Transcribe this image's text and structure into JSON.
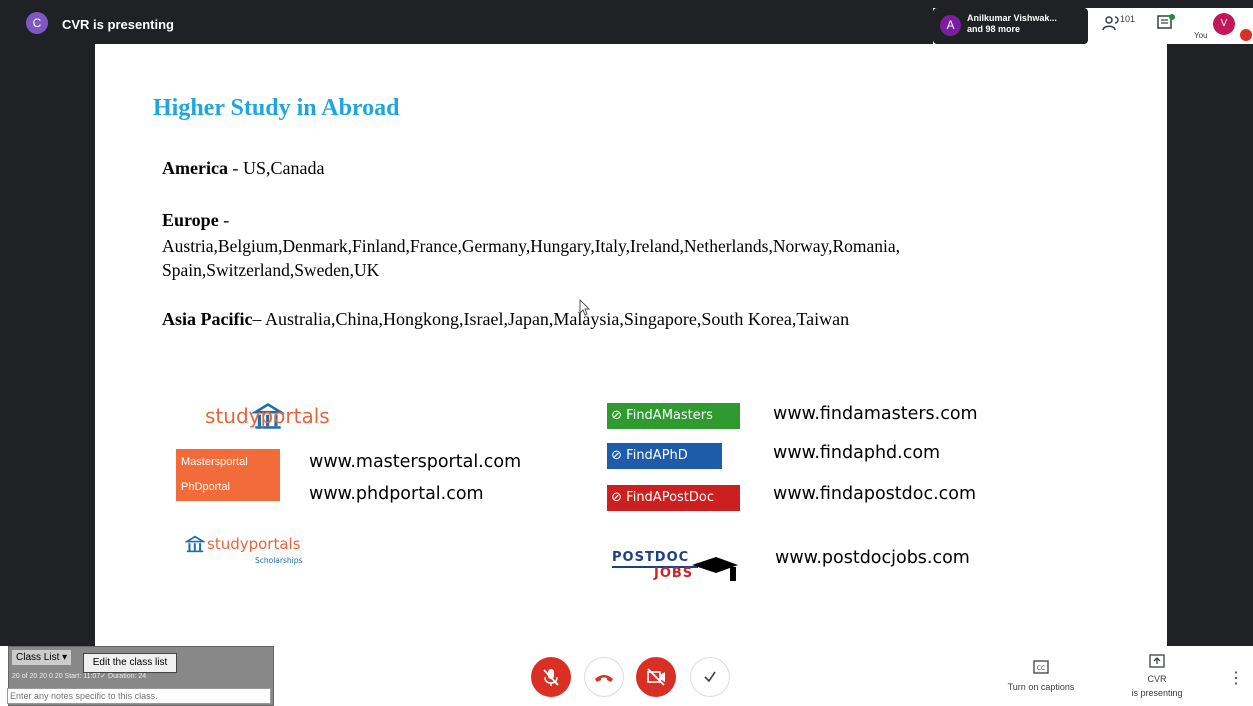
{
  "topbar": {
    "presenter_initial": "C",
    "presenter_text": "CVR is presenting",
    "people_initial": "A",
    "people_line1": "Anilkumar Vishwak...",
    "people_line2": "and 98 more",
    "participant_count": "101",
    "you_label": "You",
    "you_initial": "V"
  },
  "slide": {
    "title": "Higher Study in Abroad",
    "america_label": "America",
    "america_sep": " - ",
    "america_countries": "US,Canada",
    "europe_label": "Europe",
    "europe_sep": " -",
    "europe_countries_line1": "Austria,Belgium,Denmark,Finland,France,Germany,Hungary,Italy,Ireland,Netherlands,Norway,Romania,",
    "europe_countries_line2": "Spain,Switzerland,Sweden,UK",
    "asia_label": "Asia Pacific",
    "asia_sep": "– ",
    "asia_countries": "Australia,China,Hongkong,Israel,Japan,Malaysia,Singapore,South Korea,Taiwan",
    "logos": {
      "studyportals": "studyportals",
      "mastersportal": "Mastersportal",
      "phdportal": "PhDportal",
      "studyportals_scholarships": "studyportals",
      "scholarships_sub": "Scholarships",
      "findamasters": "FindAMasters",
      "findaphd": "FindAPhD",
      "findapostdoc": "FindAPostDoc",
      "postdoc": "POSTDOC",
      "jobs": "JOBS"
    },
    "urls": {
      "mastersportal": "www.mastersportal.com",
      "phdportal": "www.phdportal.com",
      "findamasters": "www.findamasters.com",
      "findaphd": "www.findaphd.com",
      "findapostdoc": "www.findapostdoc.com",
      "postdocjobs": "www.postdocjobs.com"
    }
  },
  "extension": {
    "class_list_label": "Class List ▾",
    "tooltip": "Edit the class list",
    "stats_text": "20 of 20   20   0   20  Start: 11:07✓ Duration: 24",
    "notes_placeholder": "Enter any notes specific to this class."
  },
  "controls": {
    "captions_label": "Turn on captions",
    "present_line1": "CVR",
    "present_line2": "is presenting",
    "more_glyph": "⋮"
  },
  "colors": {
    "title_blue": "#1ea6e0",
    "danger_red": "#d93025",
    "dark_bg": "#202124"
  }
}
